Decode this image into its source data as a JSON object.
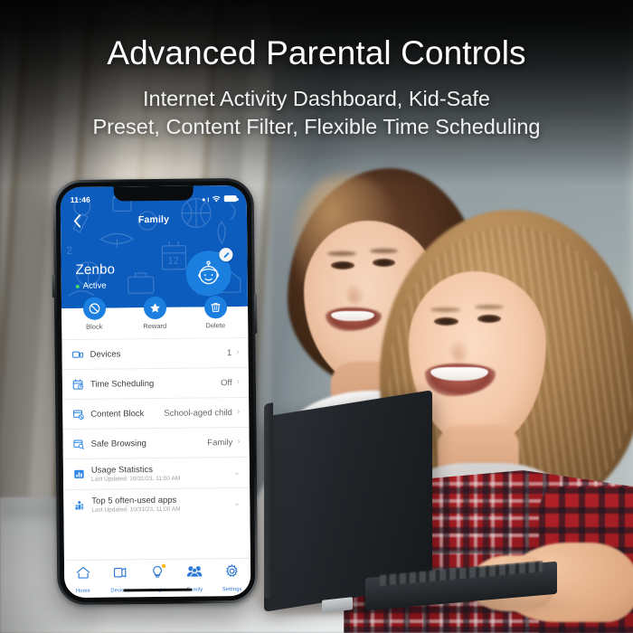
{
  "headings": {
    "title": "Advanced Parental Controls",
    "subtitle_line1": "Internet Activity Dashboard, Kid-Safe",
    "subtitle_line2": "Preset, Content Filter, Flexible Time Scheduling"
  },
  "colors": {
    "brand_blue": "#0c5cbe",
    "accent_blue": "#1b7fe0",
    "tab_blue": "#2f79d6",
    "active_green": "#49d96a",
    "badge_orange": "#ffb400"
  },
  "phone": {
    "status_bar": {
      "time": "11:46",
      "wifi_icon": "wifi-icon",
      "signal_icon": "signal-icon",
      "battery_icon": "battery-full-icon"
    },
    "nav": {
      "back_icon": "chevron-left-icon",
      "title": "Family"
    },
    "profile": {
      "name": "Zenbo",
      "status": "Active",
      "avatar_icon": "kid-avatar-icon",
      "edit_icon": "pencil-edit-icon"
    },
    "actions": [
      {
        "label": "Block",
        "icon": "block-icon"
      },
      {
        "label": "Reward",
        "icon": "star-icon"
      },
      {
        "label": "Delete",
        "icon": "trash-icon"
      }
    ],
    "settings_rows": [
      {
        "label": "Devices",
        "value": "1",
        "icon": "devices-icon",
        "chevron": "›"
      },
      {
        "label": "Time Scheduling",
        "value": "Off",
        "icon": "calendar-clock-icon",
        "chevron": "›"
      },
      {
        "label": "Content Block",
        "value": "School-aged child",
        "icon": "content-block-icon",
        "chevron": "›"
      },
      {
        "label": "Safe Browsing",
        "value": "Family",
        "icon": "safe-browsing-icon",
        "chevron": "›"
      }
    ],
    "expandable_rows": [
      {
        "label": "Usage Statistics",
        "sub": "Last Updated: 10/31/23, 11:00 AM",
        "icon": "bar-chart-icon",
        "chevron": "⌄"
      },
      {
        "label": "Top 5 often-used apps",
        "sub": "Last Updated: 10/31/23, 11:00 AM",
        "icon": "app-stats-icon",
        "chevron": "⌄"
      }
    ],
    "tabbar": [
      {
        "label": "Home",
        "icon": "home-icon",
        "badge": false
      },
      {
        "label": "Devices",
        "icon": "devices-icon",
        "badge": false
      },
      {
        "label": "Insight",
        "icon": "bulb-icon",
        "badge": true
      },
      {
        "label": "Family",
        "icon": "people-icon",
        "badge": false
      },
      {
        "label": "Settings",
        "icon": "gear-icon",
        "badge": false
      }
    ]
  }
}
